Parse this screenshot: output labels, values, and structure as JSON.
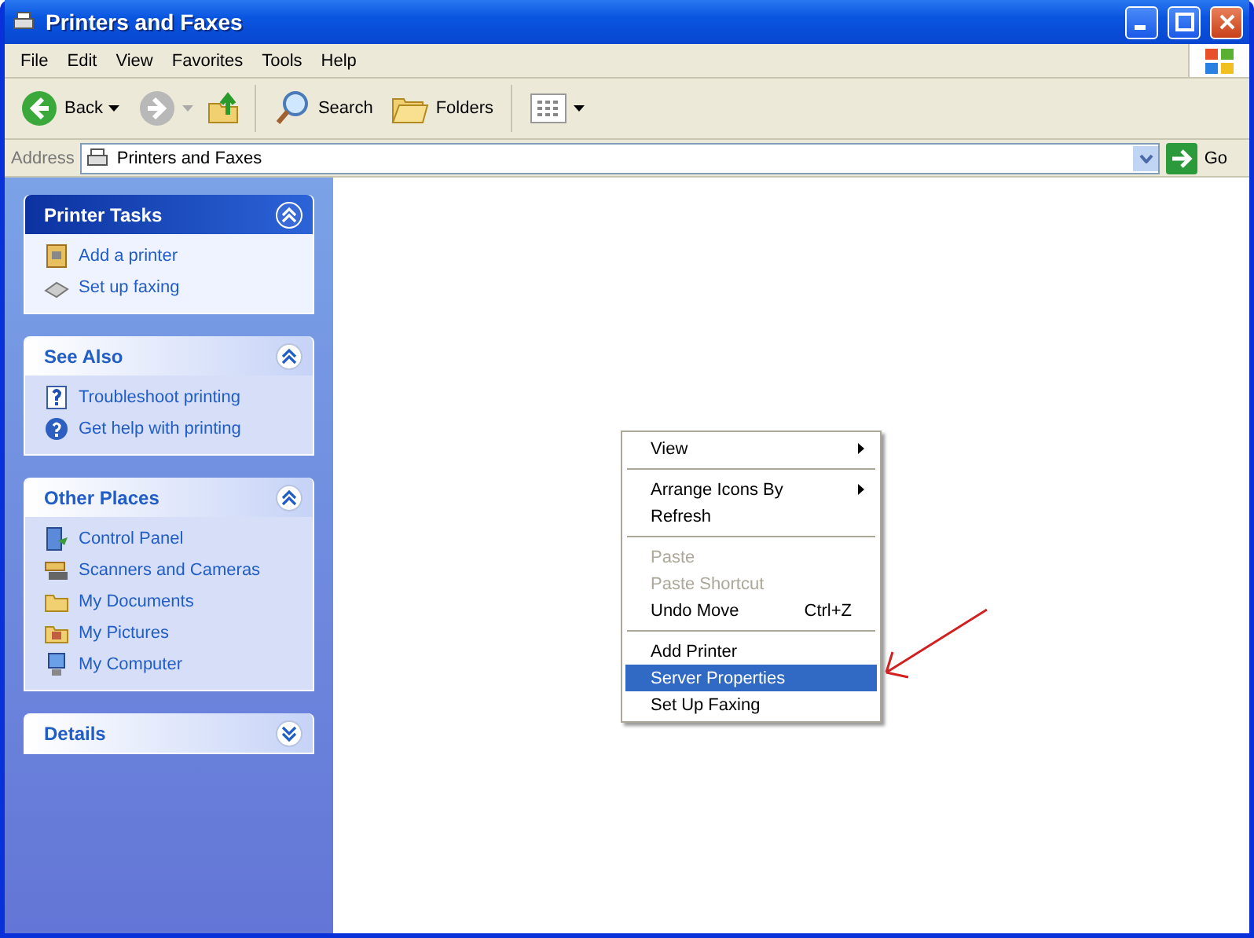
{
  "window": {
    "title": "Printers and Faxes"
  },
  "menu_bar": [
    "File",
    "Edit",
    "View",
    "Favorites",
    "Tools",
    "Help"
  ],
  "toolbar": {
    "back": "Back",
    "search": "Search",
    "folders": "Folders"
  },
  "address_bar": {
    "label": "Address",
    "value": "Printers and Faxes",
    "go": "Go"
  },
  "sidebar": {
    "panels": [
      {
        "title": "Printer Tasks",
        "kind": "primary",
        "expanded": true,
        "items": [
          "Add a printer",
          "Set up faxing"
        ]
      },
      {
        "title": "See Also",
        "kind": "normal",
        "expanded": true,
        "items": [
          "Troubleshoot printing",
          "Get help with printing"
        ]
      },
      {
        "title": "Other Places",
        "kind": "normal",
        "expanded": true,
        "items": [
          "Control Panel",
          "Scanners and Cameras",
          "My Documents",
          "My Pictures",
          "My Computer"
        ]
      },
      {
        "title": "Details",
        "kind": "normal",
        "expanded": false
      }
    ]
  },
  "context_menu": {
    "groups": [
      [
        {
          "label": "View",
          "submenu": true,
          "disabled": false,
          "selected": false
        }
      ],
      [
        {
          "label": "Arrange Icons By",
          "submenu": true,
          "disabled": false,
          "selected": false
        },
        {
          "label": "Refresh",
          "submenu": false,
          "disabled": false,
          "selected": false
        }
      ],
      [
        {
          "label": "Paste",
          "submenu": false,
          "disabled": true,
          "selected": false
        },
        {
          "label": "Paste Shortcut",
          "submenu": false,
          "disabled": true,
          "selected": false
        },
        {
          "label": "Undo Move",
          "shortcut": "Ctrl+Z",
          "submenu": false,
          "disabled": false,
          "selected": false
        }
      ],
      [
        {
          "label": "Add Printer",
          "submenu": false,
          "disabled": false,
          "selected": false
        },
        {
          "label": "Server Properties",
          "submenu": false,
          "disabled": false,
          "selected": true
        },
        {
          "label": "Set Up Faxing",
          "submenu": false,
          "disabled": false,
          "selected": false
        }
      ]
    ]
  }
}
